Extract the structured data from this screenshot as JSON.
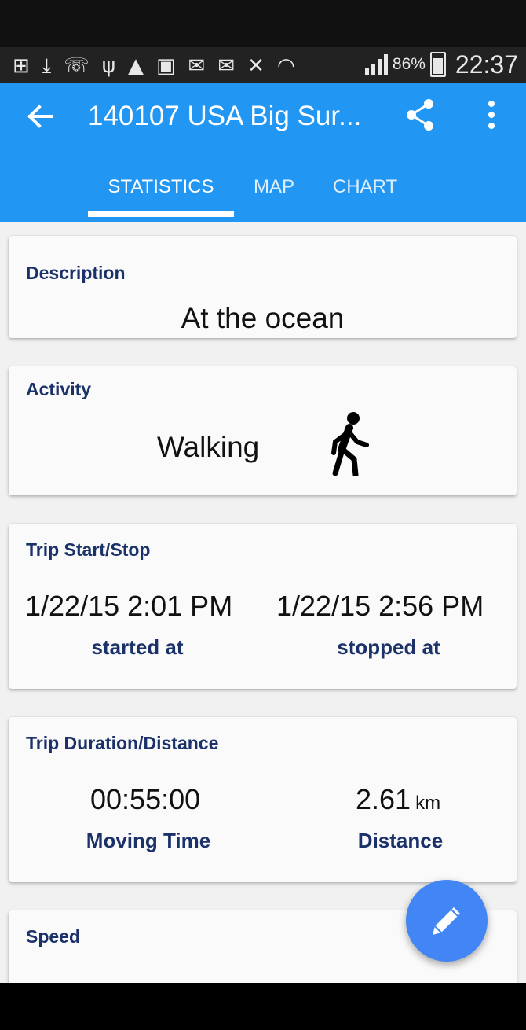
{
  "status_bar": {
    "battery_percent": "86%",
    "time": "22:37",
    "icons": [
      "plus-box-icon",
      "download-icon",
      "missed-call-icon",
      "usb-icon",
      "warning-icon",
      "calendar-icon",
      "gmail-icon",
      "mail-icon",
      "mute-icon",
      "wifi-icon",
      "signal-icon",
      "battery-icon"
    ]
  },
  "app_bar": {
    "title": "140107 USA Big Sur...",
    "tabs": [
      "STATISTICS",
      "MAP",
      "CHART"
    ],
    "active_tab": "STATISTICS",
    "colors": {
      "primary": "#2196f3",
      "label": "#1a3169",
      "fab": "#4285f4"
    }
  },
  "description": {
    "label": "Description",
    "value": "At the ocean"
  },
  "activity": {
    "label": "Activity",
    "value": "Walking",
    "icon": "walking-icon"
  },
  "trip_start_stop": {
    "label": "Trip Start/Stop",
    "start_value": "1/22/15 2:01 PM",
    "start_label": "started at",
    "stop_value": "1/22/15 2:56 PM",
    "stop_label": "stopped at"
  },
  "trip_duration_distance": {
    "label": "Trip Duration/Distance",
    "moving_time_value": "00:55:00",
    "moving_time_label": "Moving Time",
    "distance_value": "2.61",
    "distance_unit": "km",
    "distance_label": "Distance"
  },
  "speed": {
    "label": "Speed"
  },
  "fab": {
    "icon": "pencil-icon"
  }
}
